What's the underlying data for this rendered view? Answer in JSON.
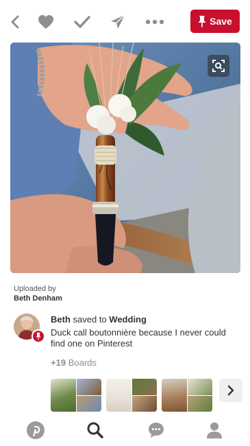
{
  "toolbar": {
    "back_icon": "chevron-left-icon",
    "like_icon": "heart-icon",
    "done_icon": "checkmark-icon",
    "send_icon": "paper-plane-icon",
    "more_icon": "ellipsis-icon",
    "save_label": "Save",
    "save_color": "#c8102e"
  },
  "pin": {
    "image_alt": "Duck call boutonniere held in hand",
    "visual_search_icon": "visual-search-icon"
  },
  "uploaded": {
    "label": "Uploaded by",
    "name": "Beth Denham"
  },
  "saved": {
    "user": "Beth",
    "saved_to_text": "saved to",
    "board": "Wedding",
    "description": "Duck call boutonnière because I never could find one on Pinterest",
    "boards_count": "+19",
    "boards_label": "Boards"
  },
  "boards": [
    {
      "colors": [
        "#6f8a4a",
        "#b99a73",
        "#7a5a3a"
      ]
    },
    {
      "colors": [
        "#e9e1d8",
        "#8d6f4e",
        "#c4a484"
      ]
    },
    {
      "colors": [
        "#d8cfc2",
        "#7c8f5a",
        "#a57b56"
      ]
    }
  ],
  "tabbar": {
    "home_icon": "pinterest-logo-icon",
    "search_icon": "search-icon",
    "messages_icon": "chat-bubble-icon",
    "profile_icon": "profile-icon"
  }
}
